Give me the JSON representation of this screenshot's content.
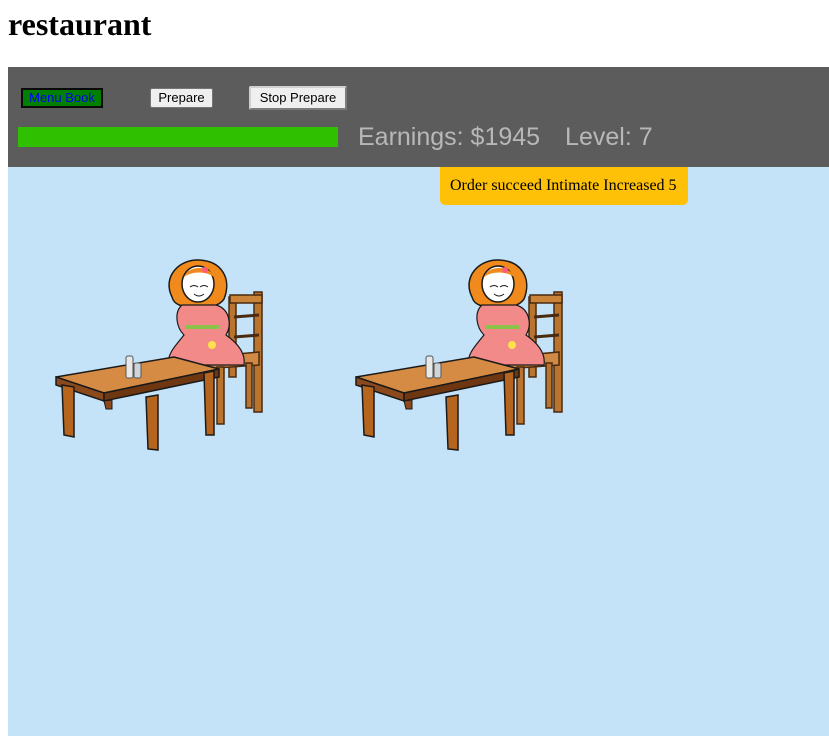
{
  "page": {
    "title": "restaurant"
  },
  "toolbar": {
    "menu_book_label": "Menu Book",
    "prepare_label": "Prepare",
    "stop_prepare_label": "Stop Prepare"
  },
  "status": {
    "progress_percent": 100,
    "earnings_text": "Earnings: $1945",
    "level_text": "Level: 7"
  },
  "notification": {
    "text": "Order succeed Intimate Increased 5"
  },
  "tables": [
    {
      "name": "table-1",
      "customer": "girl-with-orange-hair",
      "items": [
        "salt-shaker",
        "pepper-shaker"
      ]
    },
    {
      "name": "table-2",
      "customer": "girl-with-orange-hair",
      "items": [
        "salt-shaker",
        "pepper-shaker"
      ]
    }
  ],
  "colors": {
    "toolbar_bg": "#5c5c5c",
    "progress_fill": "#2fc100",
    "room_bg": "#c5e3f8",
    "toast_bg": "#ffc107",
    "menu_button_bg": "#008000"
  }
}
